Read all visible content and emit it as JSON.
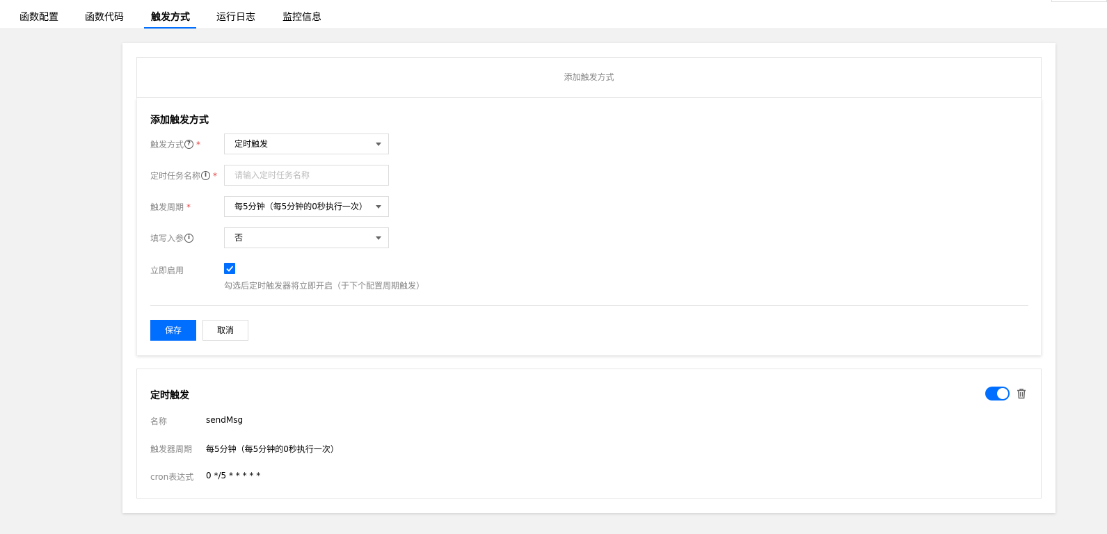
{
  "tabs": [
    {
      "label": "函数配置",
      "active": false
    },
    {
      "label": "函数代码",
      "active": false
    },
    {
      "label": "触发方式",
      "active": true
    },
    {
      "label": "运行日志",
      "active": false
    },
    {
      "label": "监控信息",
      "active": false
    }
  ],
  "add_bar_label": "添加触发方式",
  "form": {
    "title": "添加触发方式",
    "trigger_type": {
      "label": "触发方式",
      "value": "定时触发"
    },
    "task_name": {
      "label": "定时任务名称",
      "placeholder": "请输入定时任务名称"
    },
    "period": {
      "label": "触发周期",
      "value": "每5分钟（每5分钟的0秒执行一次）"
    },
    "params": {
      "label": "填写入参",
      "value": "否"
    },
    "enable": {
      "label": "立即启用",
      "checked": true,
      "hint": "勾选后定时触发器将立即开启（于下个配置周期触发）"
    },
    "save_label": "保存",
    "cancel_label": "取消"
  },
  "trigger": {
    "title": "定时触发",
    "enabled": true,
    "rows": [
      {
        "label": "名称",
        "value": "sendMsg"
      },
      {
        "label": "触发器周期",
        "value": "每5分钟（每5分钟的0秒执行一次）"
      },
      {
        "label": "cron表达式",
        "value": "0 */5 * * * * *"
      }
    ]
  },
  "colors": {
    "accent": "#006eff",
    "required": "#e54545"
  }
}
